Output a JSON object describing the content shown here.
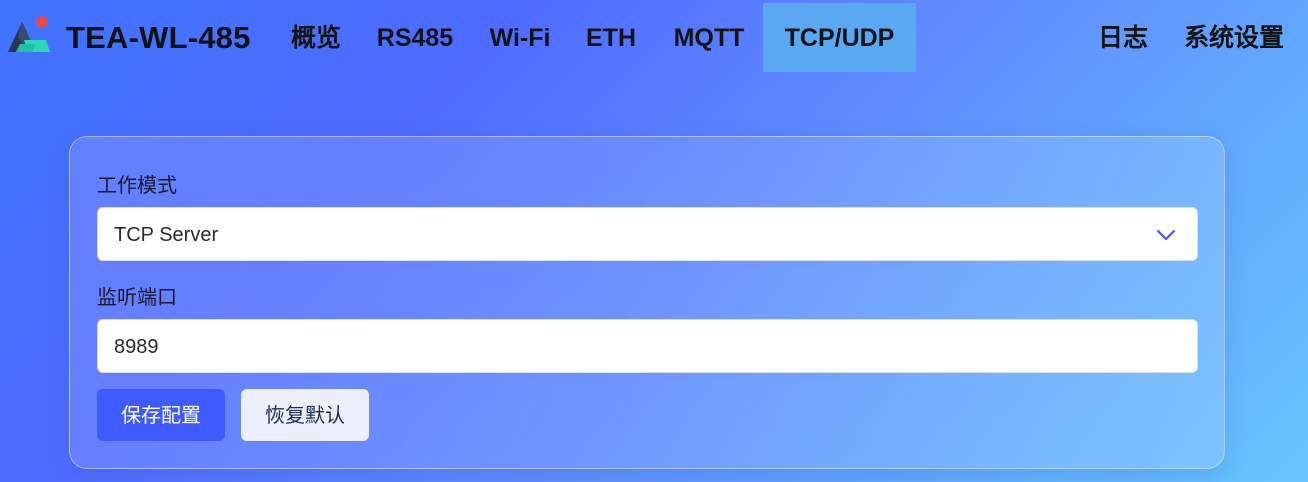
{
  "brand": {
    "name": "TEA-WL-485"
  },
  "nav": {
    "items": [
      {
        "label": "概览"
      },
      {
        "label": "RS485"
      },
      {
        "label": "Wi-Fi"
      },
      {
        "label": "ETH"
      },
      {
        "label": "MQTT"
      },
      {
        "label": "TCP/UDP",
        "active": true
      },
      {
        "label": "日志"
      },
      {
        "label": "系统设置"
      }
    ]
  },
  "form": {
    "mode": {
      "label": "工作模式",
      "value": "TCP Server"
    },
    "port": {
      "label": "监听端口",
      "value": "8989"
    },
    "save_label": "保存配置",
    "reset_label": "恢复默认"
  },
  "colors": {
    "accent": "#3f5bff",
    "nav_active": "#5aa8f2",
    "logo_dot": "#e5484d"
  },
  "icons": {
    "logo": "brand-logo-icon",
    "select_arrow": "chevron-down-icon"
  }
}
